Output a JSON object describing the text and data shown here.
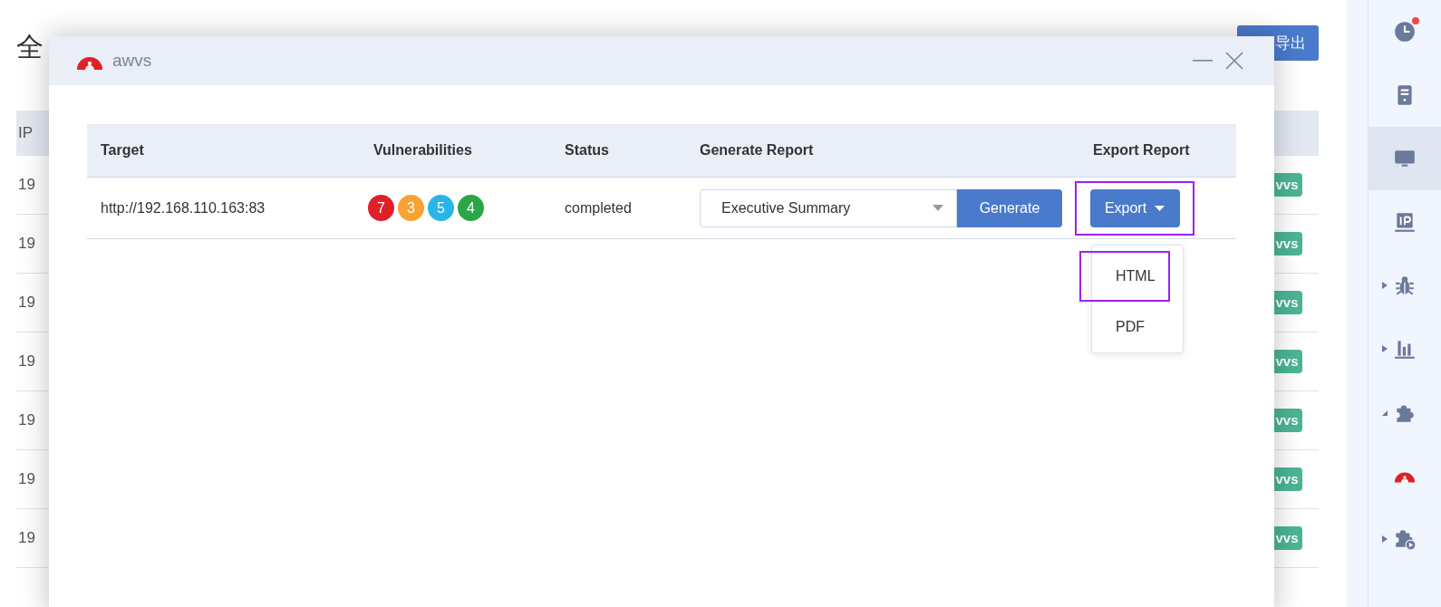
{
  "background_page": {
    "title": "全",
    "export_button": "导出",
    "table": {
      "columns": [
        "IP"
      ],
      "rows": [
        {
          "ip": "19",
          "tag": "vvs"
        },
        {
          "ip": "19",
          "tag": "vvs"
        },
        {
          "ip": "19",
          "tag": "vvs"
        },
        {
          "ip": "19",
          "tag": "vvs"
        },
        {
          "ip": "19",
          "tag": "vvs"
        },
        {
          "ip": "19",
          "tag": "vvs"
        },
        {
          "ip": "19",
          "tag": "vvs"
        }
      ]
    }
  },
  "sidebar": {
    "items": [
      {
        "kind": "clock",
        "selected": false,
        "notification": true
      },
      {
        "kind": "server",
        "selected": false,
        "notification": false
      },
      {
        "kind": "monitor",
        "selected": true,
        "notification": false
      },
      {
        "kind": "ip",
        "selected": false,
        "notification": false
      },
      {
        "kind": "bug",
        "selected": false,
        "notification": false,
        "expanded": false
      },
      {
        "kind": "chart",
        "selected": false,
        "notification": false,
        "expanded": false
      },
      {
        "kind": "puzzle",
        "selected": false,
        "notification": false,
        "expanded": true
      },
      {
        "kind": "logo",
        "selected": false,
        "notification": false
      },
      {
        "kind": "plugin-run",
        "selected": false,
        "notification": false,
        "expanded": false
      }
    ]
  },
  "dialog": {
    "title": "awvs",
    "table": {
      "columns": [
        "Target",
        "Vulnerabilities",
        "Status",
        "Generate Report",
        "Export Report"
      ],
      "rows": [
        {
          "target": "http://192.168.110.163:83",
          "vulnerabilities": [
            {
              "count": "7",
              "color": "#e02027"
            },
            {
              "count": "3",
              "color": "#f8a233"
            },
            {
              "count": "5",
              "color": "#29b5e6"
            },
            {
              "count": "4",
              "color": "#2aa744"
            }
          ],
          "status": "completed",
          "report_template": "Executive Summary",
          "generate_button": "Generate",
          "export_button": "Export",
          "export_highlighted": true
        }
      ]
    },
    "export_menu": {
      "items": [
        {
          "label": "HTML",
          "highlighted": true
        },
        {
          "label": "PDF",
          "highlighted": false
        }
      ]
    }
  }
}
